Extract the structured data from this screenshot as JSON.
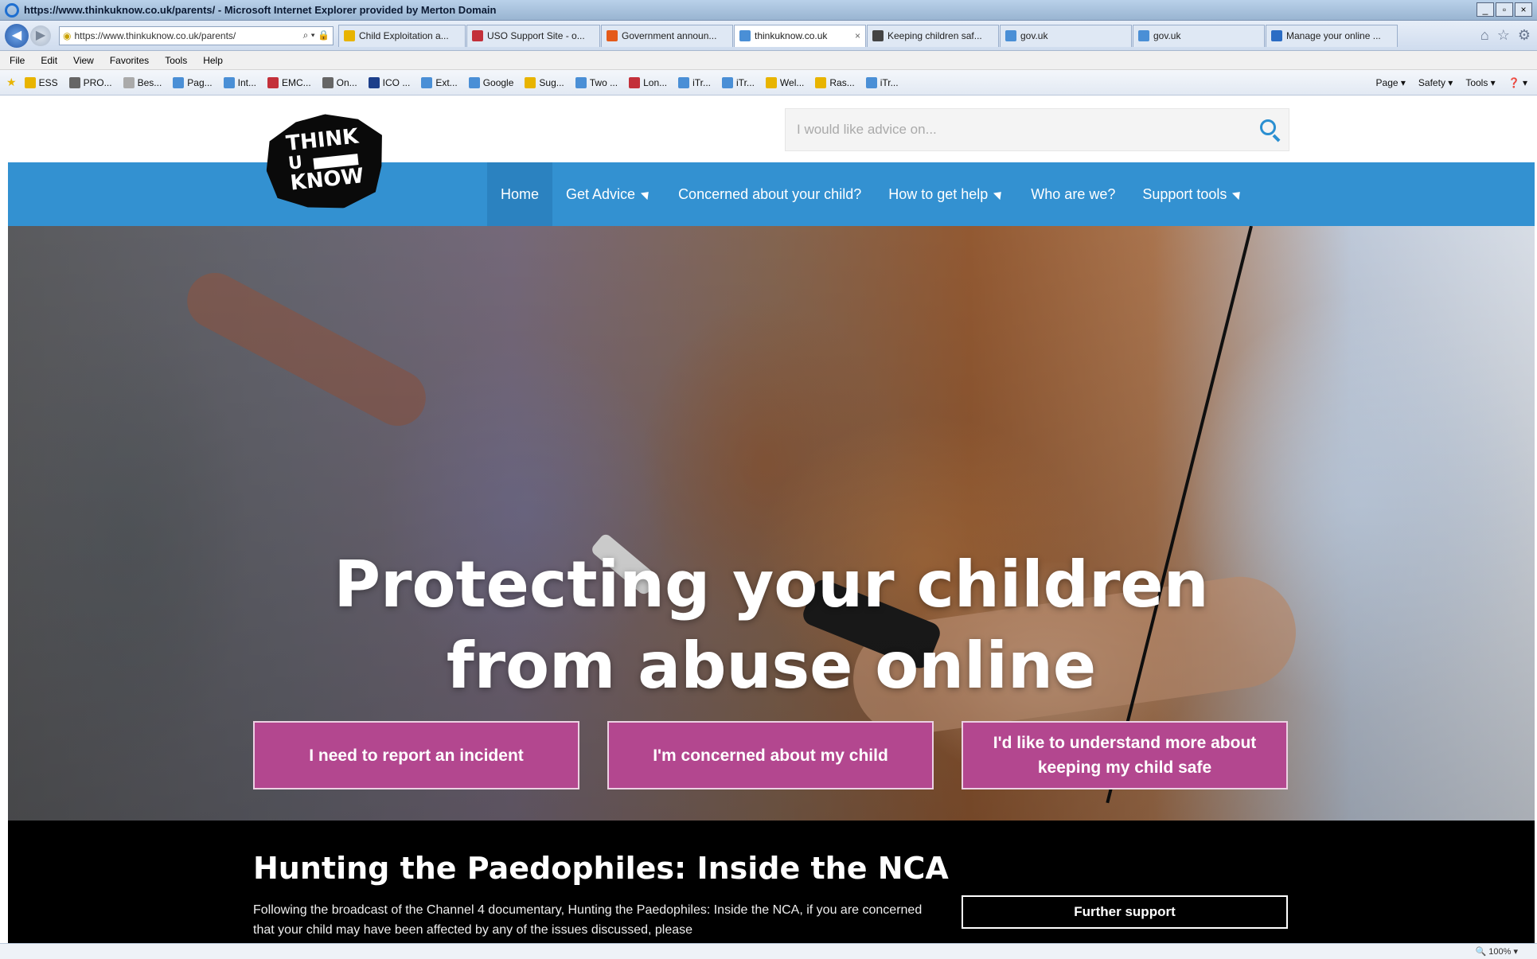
{
  "window": {
    "title": "https://www.thinkuknow.co.uk/parents/ - Microsoft Internet Explorer provided by Merton Domain",
    "controls": [
      "_",
      "▫",
      "×"
    ]
  },
  "address_bar": {
    "url": "https://www.thinkuknow.co.uk/parents/",
    "icons": "⌕ ▾ 🔒"
  },
  "tabs": [
    {
      "label": "Child Exploitation a...",
      "color": "#e8b400"
    },
    {
      "label": "USO Support Site - o...",
      "color": "#c3303a"
    },
    {
      "label": "Government announ...",
      "color": "#e45a1a"
    },
    {
      "label": "thinkuknow.co.uk",
      "color": "#4a8fd6",
      "active": true,
      "close": "×"
    },
    {
      "label": "Keeping children saf...",
      "color": "#444444"
    },
    {
      "label": "gov.uk",
      "color": "#4a8fd6"
    },
    {
      "label": "gov.uk",
      "color": "#4a8fd6"
    },
    {
      "label": "Manage your online ...",
      "color": "#2b6cc4"
    }
  ],
  "menu": [
    "File",
    "Edit",
    "View",
    "Favorites",
    "Tools",
    "Help"
  ],
  "favorites": [
    {
      "label": "ESS",
      "color": "#e8b400"
    },
    {
      "label": "PRO...",
      "color": "#666666"
    },
    {
      "label": "Bes...",
      "color": "#aaaaaa"
    },
    {
      "label": "Pag...",
      "color": "#4a8fd6"
    },
    {
      "label": "Int...",
      "color": "#4a8fd6"
    },
    {
      "label": "EMC...",
      "color": "#c3303a"
    },
    {
      "label": "On...",
      "color": "#666666"
    },
    {
      "label": "ICO ...",
      "color": "#1d3f8a"
    },
    {
      "label": "Ext...",
      "color": "#4a8fd6"
    },
    {
      "label": "Google",
      "color": "#4a8fd6"
    },
    {
      "label": "Sug...",
      "color": "#e8b400"
    },
    {
      "label": "Two ...",
      "color": "#4a8fd6"
    },
    {
      "label": "Lon...",
      "color": "#c3303a"
    },
    {
      "label": "iTr...",
      "color": "#4a8fd6"
    },
    {
      "label": "iTr...",
      "color": "#4a8fd6"
    },
    {
      "label": "Wel...",
      "color": "#e8b400"
    },
    {
      "label": "Ras...",
      "color": "#e8b400"
    },
    {
      "label": "iTr...",
      "color": "#4a8fd6"
    }
  ],
  "command_bar": [
    "Page ▾",
    "Safety ▾",
    "Tools ▾",
    "❓ ▾"
  ],
  "site": {
    "logo": {
      "line1": "THINK",
      "line2": "U",
      "line3": "KNOW"
    },
    "search_placeholder": "I would like advice on...",
    "nav": [
      {
        "label": "Home",
        "active": true,
        "caret": false
      },
      {
        "label": "Get Advice",
        "caret": true
      },
      {
        "label": "Concerned about your child?",
        "caret": false
      },
      {
        "label": "How to get help",
        "caret": true
      },
      {
        "label": "Who are we?",
        "caret": false
      },
      {
        "label": "Support tools",
        "caret": true
      }
    ],
    "hero": {
      "headline_line1": "Protecting your children",
      "headline_line2": "from abuse online",
      "cta1": "I need to report an incident",
      "cta2": "I'm concerned about my child",
      "cta3": "I'd like to understand more about keeping my child safe"
    },
    "news": {
      "heading": "Hunting the Paedophiles: Inside the NCA",
      "body": "Following the broadcast of the Channel 4 documentary, Hunting the Paedophiles: Inside the NCA, if you are concerned that your child may have been affected by any of the issues discussed, please",
      "button": "Further support"
    }
  },
  "status": {
    "zoom": "100%"
  },
  "colors": {
    "nav": "#3391d1",
    "cta": "#b3478f",
    "news_bg": "#000000"
  }
}
